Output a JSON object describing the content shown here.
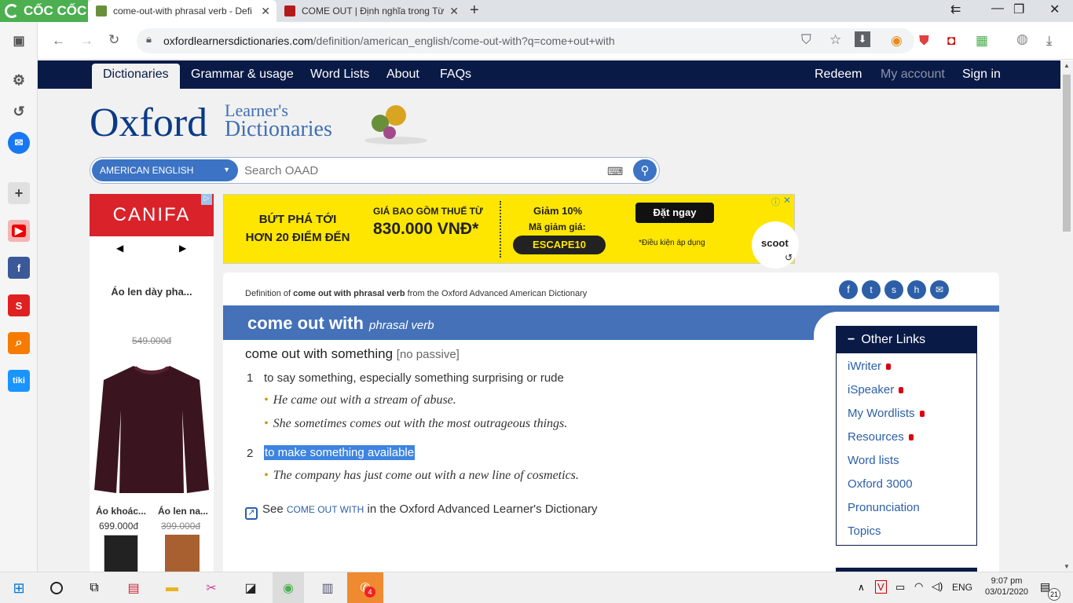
{
  "browser": {
    "logo": "CỐC CỐC",
    "tabs": [
      {
        "title": "come-out-with phrasal verb - Defi",
        "active": true
      },
      {
        "title": "COME OUT | Định nghĩa trong Từ đ",
        "active": false
      }
    ],
    "url_host": "oxfordlearnersdictionaries.com",
    "url_path": "/definition/american_english/come-out-with?q=come+out+with"
  },
  "nav": {
    "items": [
      "Dictionaries",
      "Grammar & usage",
      "Word Lists",
      "About",
      "FAQs"
    ],
    "redeem": "Redeem",
    "my_account": "My account",
    "sign_in": "Sign in"
  },
  "brand": {
    "oxford": "Oxford",
    "line1": "Learner's",
    "line2": "Dictionaries"
  },
  "search": {
    "dict": "AMERICAN ENGLISH",
    "placeholder": "Search OAAD"
  },
  "ad_canifa": {
    "brand": "CANIFA",
    "prev": "◀",
    "next": "▶",
    "product": "Áo len dày pha...",
    "old_price": "549.000đ",
    "p1_name": "Áo khoác...",
    "p1_price": "699.000đ",
    "p2_name": "Áo len na...",
    "p2_price": "399.000đ"
  },
  "ad_banner": {
    "l1": "BỨT PHÁ TỚI",
    "l2": "HƠN 20 ĐIỂM ĐẾN",
    "price_label": "GIÁ BAO GỒM THUẾ TỪ",
    "price": "830.000 VNĐ*",
    "discount": "Giảm 10%",
    "code_label": "Mã giảm giá:",
    "code": "ESCAPE10",
    "cta": "Đặt ngay",
    "note": "*Điều kiện áp dụng",
    "brand": "scoot"
  },
  "entry": {
    "source_pre": "Definition of",
    "source_word": "come out with phrasal verb",
    "source_post": "from the Oxford Advanced American Dictionary",
    "headword": "come out with",
    "pos": "phrasal verb",
    "pattern": "come out with something",
    "grammar": "[no passive]",
    "senses": [
      {
        "num": "1",
        "def": "to say something, especially something surprising or rude",
        "examples": [
          "He came out with a stream of abuse.",
          "She sometimes comes out with the most outrageous things."
        ]
      },
      {
        "num": "2",
        "def": "to make something available",
        "examples": [
          "The company has just come out with a new line of cosmetics."
        ]
      }
    ],
    "see_pre": "See",
    "see_link": "COME OUT WITH",
    "see_post": "in the Oxford Advanced Learner's Dictionary"
  },
  "other_links": {
    "title": "Other Links",
    "items": [
      "iWriter",
      "iSpeaker",
      "My Wordlists",
      "Resources",
      "Word lists",
      "Oxford 3000",
      "Pronunciation",
      "Topics"
    ]
  },
  "taskbar": {
    "lang": "ENG",
    "time": "9:07 pm",
    "date": "03/01/2020",
    "notif": "21",
    "badge": "4"
  }
}
